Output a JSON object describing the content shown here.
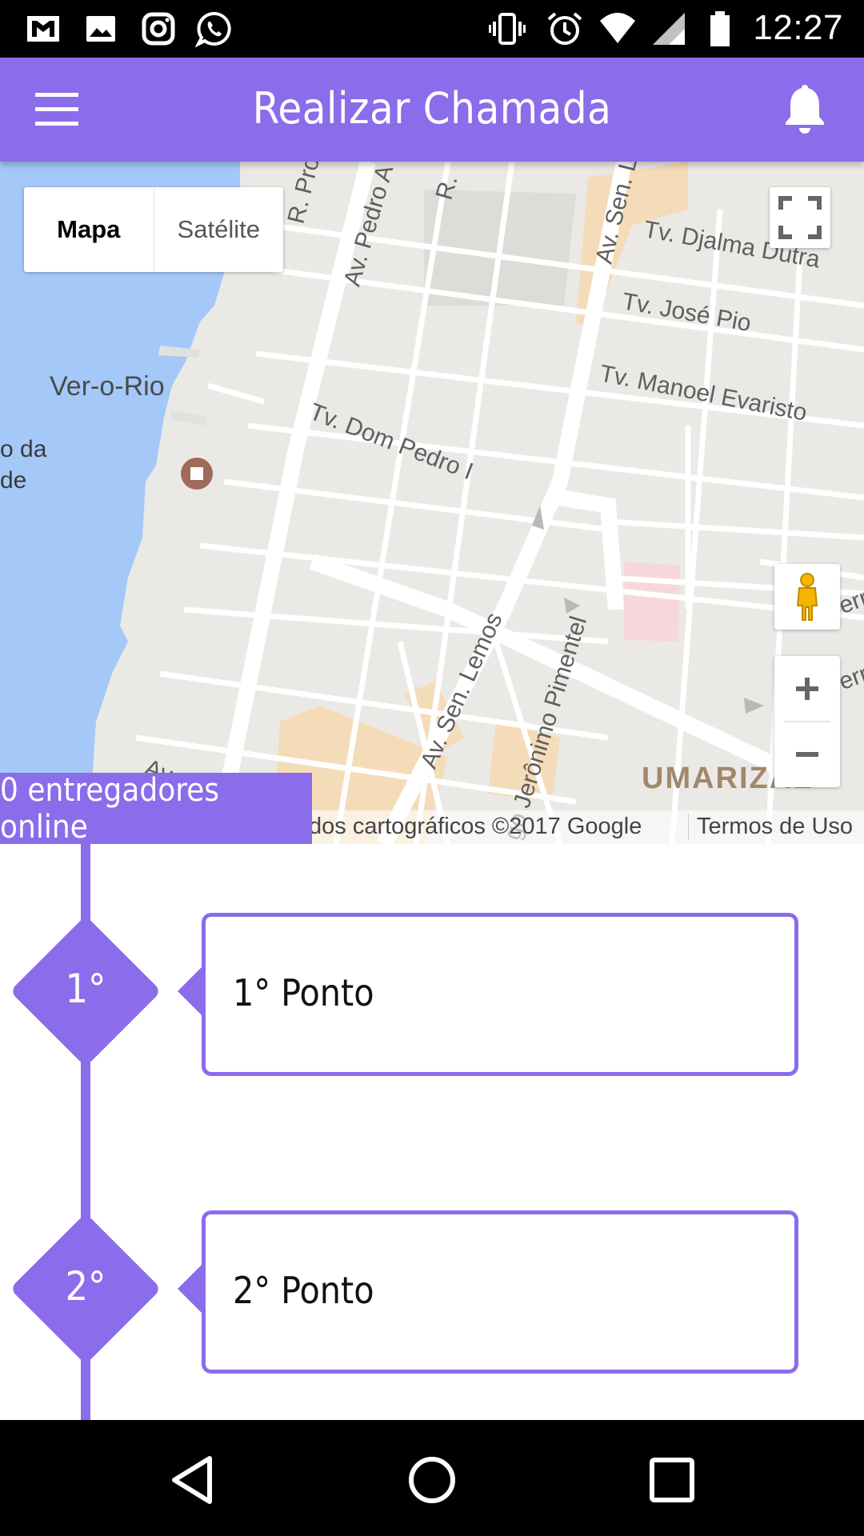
{
  "status_bar": {
    "time": "12:27",
    "notification_icons": [
      "gmail-icon",
      "gallery-icon",
      "instagram-icon",
      "whatsapp-icon"
    ],
    "system_icons": [
      "vibrate-icon",
      "alarm-icon",
      "wifi-icon",
      "signal-icon",
      "battery-icon"
    ]
  },
  "app_bar": {
    "title": "Realizar Chamada",
    "left_icon": "menu-icon",
    "right_icon": "bell-icon",
    "background": "#8b6cea"
  },
  "map": {
    "type_control": {
      "options": [
        "Mapa",
        "Satélite"
      ],
      "selected": "Mapa"
    },
    "labels": {
      "r_prof": "R. Prof.",
      "av_pedro": "Av. Pedro A",
      "r_top": "R.",
      "av_sen_lem_top": "Av. Sen. Lem",
      "djalma": "Tv. Djalma Dutra",
      "jose_pio": "Tv. José Pio",
      "manoel": "Tv. Manoel Evaristo",
      "ver_o_rio": "Ver-o-Rio",
      "o_da": "o da",
      "de": "de",
      "dom_pedro": "Tv. Dom Pedro I",
      "av_sen_lemos": "Av. Sen. Lemos",
      "jeronimo": "go Jerônimo Pimentel",
      "av_bottom": "Av.",
      "umarizal": "UMARIZAL",
      "edge_right_1": "err",
      "edge_right_2": "err"
    },
    "attribution": "dos cartográficos ©2017 Google",
    "terms": "Termos de Uso",
    "controls": [
      "fullscreen-icon",
      "pegman-icon",
      "zoom-in-icon",
      "zoom-out-icon"
    ],
    "colors": {
      "land": "#ebe9e6",
      "water": "#a4c8f8",
      "road": "#ffffff",
      "commercial": "#f5dcb9",
      "poi": "#f6d8dc"
    }
  },
  "online_badge": "0 entregadores online",
  "timeline": {
    "steps": [
      {
        "number": "1°",
        "placeholder": "1° Ponto"
      },
      {
        "number": "2°",
        "placeholder": "2° Ponto"
      }
    ]
  },
  "nav_bar": {
    "buttons": [
      "back-icon",
      "home-icon",
      "recents-icon"
    ]
  }
}
